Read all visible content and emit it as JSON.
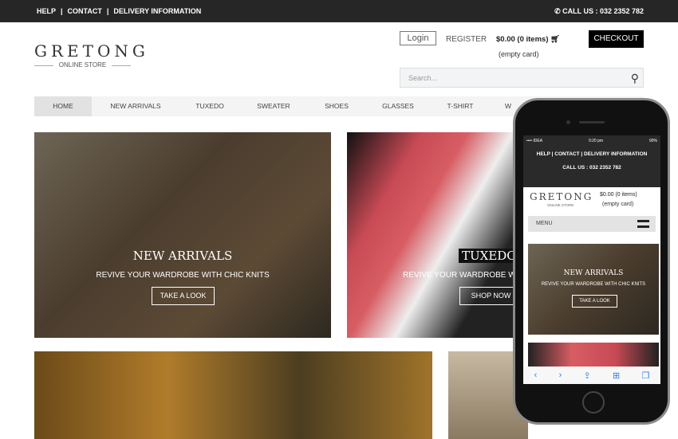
{
  "topbar": {
    "links": [
      "HELP",
      "CONTACT",
      "DELIVERY INFORMATION"
    ],
    "call": "CALL US : 032 2352 782",
    "phone_icon": "phone-icon"
  },
  "header": {
    "logo": "GRETONG",
    "logo_sub": "ONLINE STORE",
    "login": "Login",
    "register": "REGISTER",
    "cart": "$0.00 (0 items)",
    "cart_status": "(empty card)",
    "checkout": "CHECKOUT",
    "search_placeholder": "Search..."
  },
  "nav": [
    "HOME",
    "NEW ARRIVALS",
    "TUXEDO",
    "SWEATER",
    "SHOES",
    "GLASSES",
    "T-SHIRT",
    "W"
  ],
  "banners": [
    {
      "title": "NEW ARRIVALS",
      "subtitle": "REVIVE YOUR WARDROBE WITH CHIC KNITS",
      "button": "TAKE A LOOK"
    },
    {
      "title": "TUXEDO",
      "subtitle": "REVIVE YOUR WARDROBE WI",
      "button": "SHOP NOW"
    }
  ],
  "phone": {
    "carrier": "•••• IDEA",
    "time": "9:20 pm",
    "battery": "90%",
    "links": "HELP | CONTACT | DELIVERY INFORMATION",
    "call": "CALL US : 032 2352 782",
    "logo": "GRETONG",
    "logo_sub": "ONLINE STORE",
    "cart": "$0.00 (0 items)",
    "cart_status": "(empty card)",
    "menu": "MENU",
    "banner_title": "NEW ARRIVALS",
    "banner_subtitle": "REVIVE YOUR WARDROBE WITH CHIC KNITS",
    "banner_button": "TAKE A LOOK"
  }
}
